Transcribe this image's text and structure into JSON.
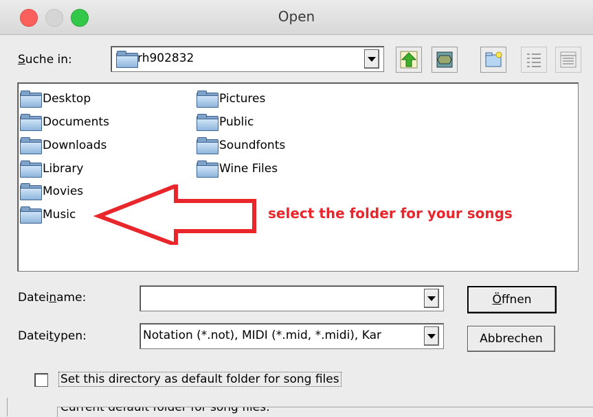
{
  "window": {
    "title": "Open"
  },
  "lookin": {
    "label_pre": "",
    "label_ul": "S",
    "label_post": "uche in:",
    "value": "rh902832"
  },
  "toolbar": {
    "up_icon": "up-folder-arrow-icon",
    "desktop_icon": "desktop-icon",
    "new_folder_icon": "new-folder-icon",
    "list_icon": "list-view-icon",
    "details_icon": "details-view-icon"
  },
  "files": {
    "col1": [
      "Desktop",
      "Documents",
      "Downloads",
      "Library",
      "Movies",
      "Music"
    ],
    "col2": [
      "Pictures",
      "Public",
      "Soundfonts",
      "Wine Files"
    ]
  },
  "annotation": {
    "text": "select the folder for your songs",
    "color": "#e8262c"
  },
  "filename": {
    "label_pre": "Datei",
    "label_ul": "n",
    "label_post": "ame:",
    "value": ""
  },
  "filetype": {
    "label_pre": "Datei",
    "label_ul": "t",
    "label_post": "ypen:",
    "value": "Notation (*.not), MIDI (*.mid, *.midi), Kar"
  },
  "buttons": {
    "open_ul": "Ö",
    "open_post": "ffnen",
    "cancel": "Abbrechen"
  },
  "checkbox": {
    "label": "Set this directory as default folder for song files",
    "checked": false
  },
  "current_default": {
    "text": "Current default folder for song files:"
  }
}
